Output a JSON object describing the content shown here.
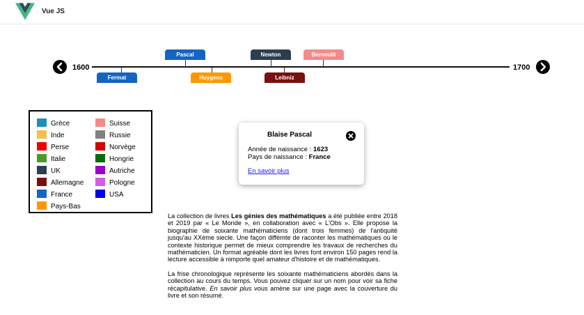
{
  "app": {
    "title": "Vue JS"
  },
  "timeline": {
    "start_year": "1600",
    "end_year": "1700",
    "prev_icon": "chevron-left-icon",
    "next_icon": "chevron-right-icon",
    "people_above": [
      {
        "name": "Pascal",
        "color": "#1565c0"
      },
      {
        "name": "Newton",
        "color": "#2c3e50"
      },
      {
        "name": "Bernoulli",
        "color": "#f48a8a"
      }
    ],
    "people_below": [
      {
        "name": "Fermat",
        "color": "#1565c0"
      },
      {
        "name": "Huygens",
        "color": "#ff9800"
      },
      {
        "name": "Leibniz",
        "color": "#7b0f0f"
      }
    ]
  },
  "legend": {
    "items": [
      {
        "label": "Grèce",
        "color": "#1f8fb5"
      },
      {
        "label": "Inde",
        "color": "#f3c04c"
      },
      {
        "label": "Perse",
        "color": "#f20000"
      },
      {
        "label": "Italie",
        "color": "#4a9a2a"
      },
      {
        "label": "UK",
        "color": "#2c3e50"
      },
      {
        "label": "Allemagne",
        "color": "#7b0f0f"
      },
      {
        "label": "France",
        "color": "#1565c0"
      },
      {
        "label": "Pays-Bas",
        "color": "#ff9800"
      },
      {
        "label": "Suisse",
        "color": "#f48a8a"
      },
      {
        "label": "Russie",
        "color": "#808080"
      },
      {
        "label": "Norvège",
        "color": "#d40000"
      },
      {
        "label": "Hongrie",
        "color": "#0a6a0a"
      },
      {
        "label": "Autriche",
        "color": "#9b00c8"
      },
      {
        "label": "Pologne",
        "color": "#d35ee0"
      },
      {
        "label": "USA",
        "color": "#0000ee"
      }
    ]
  },
  "card": {
    "title": "Blaise Pascal",
    "birth_label": "Année de naissance : ",
    "birth_value": "1623",
    "country_label": "Pays de naissance : ",
    "country_value": "France",
    "link": "En savoir plus",
    "close_icon": "close-icon"
  },
  "description": {
    "p1_before": "La collection de livres ",
    "p1_bold": "Les génies des mathématiques",
    "p1_after": " a été publiée entre 2018 et 2019 par « Le Monde », en collaboration avec « L'Obs ». Elle propose la biographie de soixante mathématiciens (dont trois femmes) de l'antiquité jusqu'au XXème siecle. Une façon diffémte de raconter les mathématiques où le contexte historique permet de mieux comprendre les travaux de recherches du mathématicien. Un format agréable dont les livres font environ 150 pages rend la lecture accessible à nimporte quel amateur d'histoire et de mathématiques.",
    "p2_before": "La frise chronologique représente les soixante mathématiciens abordés dans la collection au cours du temps. Vous pouvez cliquer sur un nom pour voir sa fiche récapitulative. ",
    "p2_italic": "En savoir plus",
    "p2_after": " vous amène sur une page avec la couverture du livre et son résumé."
  }
}
